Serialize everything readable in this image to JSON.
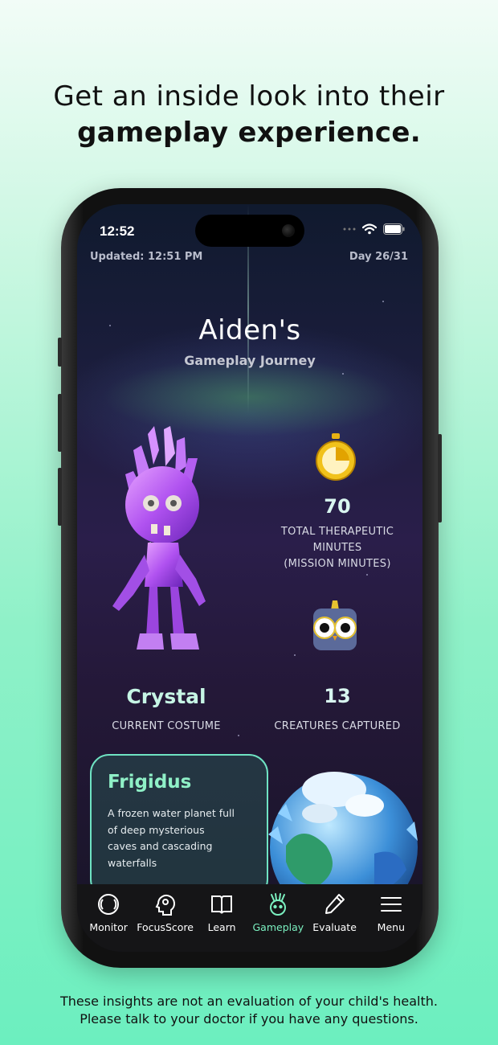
{
  "promo": {
    "headline_line1": "Get an inside look into their",
    "headline_line2": "gameplay experience.",
    "disclaimer_line1": "These insights are not an evaluation of your child's health.",
    "disclaimer_line2": "Please talk to your doctor if you have any questions."
  },
  "status_bar": {
    "time": "12:52",
    "icons": [
      "signal-dots-icon",
      "wifi-icon",
      "battery-icon"
    ]
  },
  "header": {
    "updated": "Updated: 12:51 PM",
    "day": "Day 26/31"
  },
  "journey": {
    "name": "Aiden's",
    "subtitle": "Gameplay Journey"
  },
  "stats": {
    "therapeutic_minutes": "70",
    "therapeutic_label_1": "TOTAL THERAPEUTIC",
    "therapeutic_label_2": "MINUTES",
    "therapeutic_label_3": "(MISSION MINUTES)",
    "costume_name": "Crystal",
    "costume_label": "CURRENT COSTUME",
    "creatures_captured": "13",
    "creatures_label": "CREATURES CAPTURED"
  },
  "planet": {
    "title": "Frigidus",
    "description": "A frozen water planet full of deep mysterious caves and cascading waterfalls"
  },
  "tabs": [
    {
      "label": "Monitor",
      "icon": "monitor-rings-icon"
    },
    {
      "label": "FocusScore",
      "icon": "head-gear-icon"
    },
    {
      "label": "Learn",
      "icon": "open-book-icon"
    },
    {
      "label": "Gameplay",
      "icon": "creature-face-icon",
      "active": true
    },
    {
      "label": "Evaluate",
      "icon": "pencil-icon"
    },
    {
      "label": "Menu",
      "icon": "hamburger-menu-icon"
    }
  ],
  "colors": {
    "accent": "#7bf0c0",
    "background_top": "#f2fcf7",
    "background_bottom": "#6cefbf",
    "card_border": "#6fe3c3"
  }
}
